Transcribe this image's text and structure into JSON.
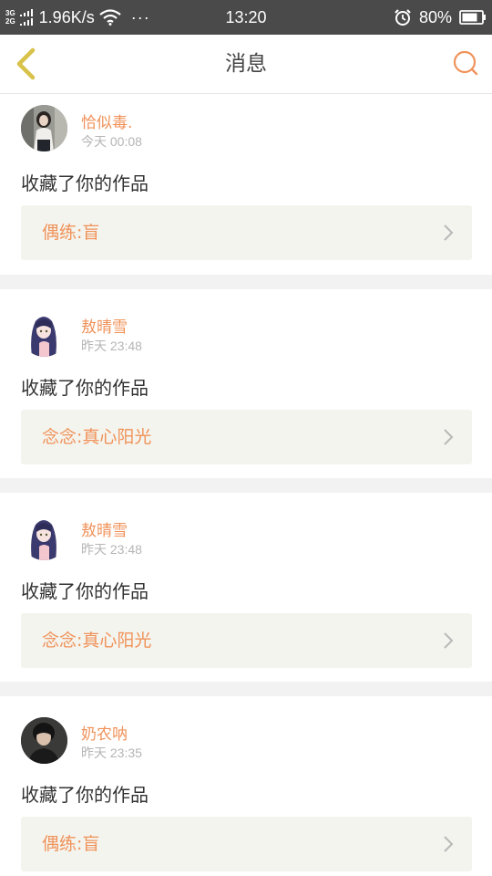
{
  "status_bar": {
    "net_top": "3G",
    "net_bottom": "2G",
    "speed": "1.96K/s",
    "dots": "···",
    "time": "13:20",
    "battery": "80%",
    "icons": [
      "signal-icon",
      "wifi-icon",
      "alarm-icon",
      "battery-icon"
    ]
  },
  "nav": {
    "title": "消息",
    "back_icon": "chevron-left-icon",
    "search_icon": "search-icon",
    "accent_color": "#f0925a",
    "back_color": "#d9c24a"
  },
  "messages": [
    {
      "user": "恰似毒.",
      "time": "今天 00:08",
      "action": "收藏了你的作品",
      "work": "偶练:盲"
    },
    {
      "user": "敖晴雪",
      "time": "昨天 23:48",
      "action": "收藏了你的作品",
      "work": "念念:真心阳光"
    },
    {
      "user": "敖晴雪",
      "time": "昨天 23:48",
      "action": "收藏了你的作品",
      "work": "念念:真心阳光"
    },
    {
      "user": "奶农呐",
      "time": "昨天 23:35",
      "action": "收藏了你的作品",
      "work": "偶练:盲"
    }
  ]
}
